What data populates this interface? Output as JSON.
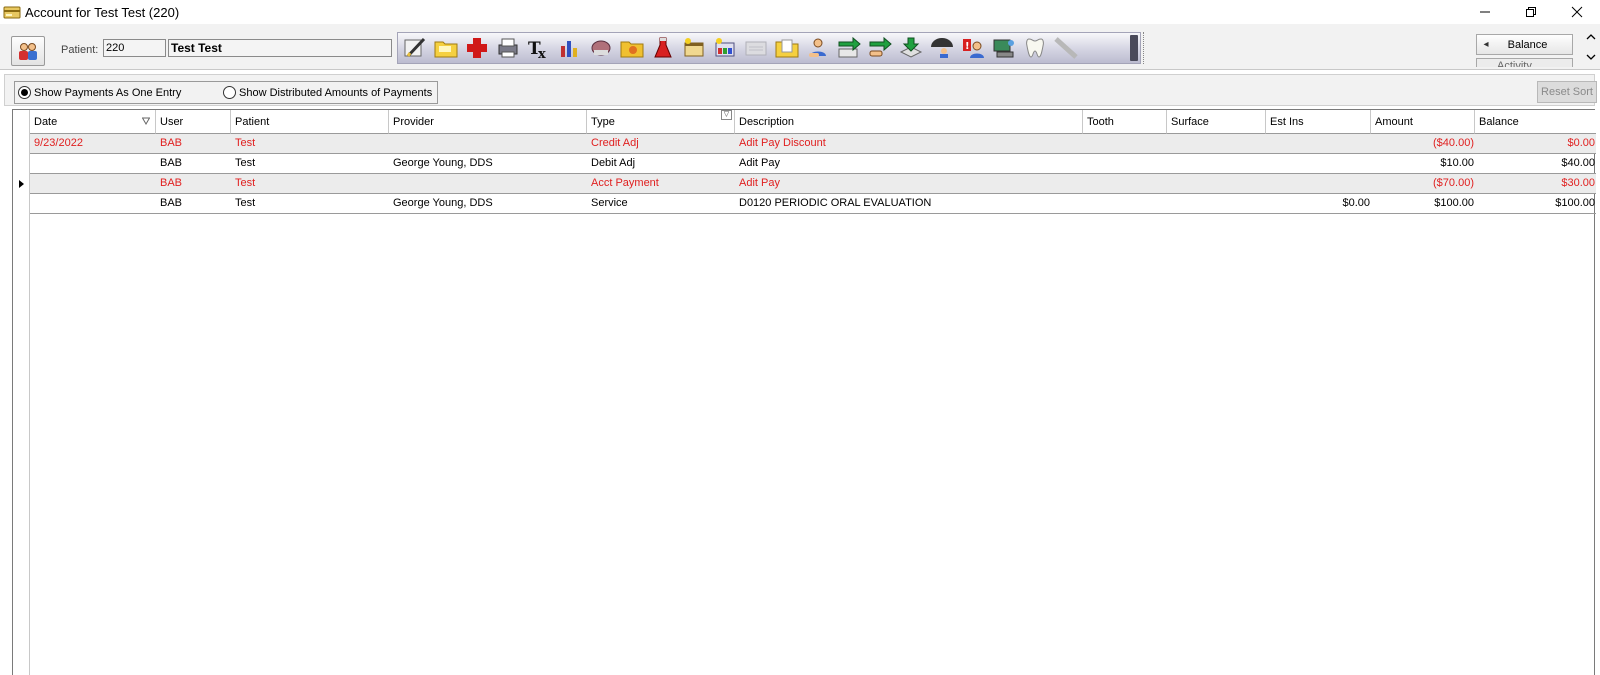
{
  "window": {
    "title": "Account for Test Test (220)"
  },
  "header": {
    "patient_label": "Patient:",
    "patient_num": "220",
    "patient_name": "Test Test",
    "toolbar_icons": [
      "edit-pen-icon",
      "folder-icon",
      "medical-cross-icon",
      "printer-icon",
      "tx-icon",
      "chart-bars-icon",
      "tooth-pink-icon",
      "folder-orange-icon",
      "flask-icon",
      "new-window-icon",
      "new-window-color-icon",
      "blank-card-icon",
      "folder-open-icon",
      "user-hand-icon",
      "arrow-right-green-icon",
      "arrow-right-hand-icon",
      "download-tray-icon",
      "umbrella-person-icon",
      "alert-person-icon",
      "computer-icon",
      "tooth-icon",
      "ruler-icon"
    ],
    "balance_label": "Balance",
    "activity_label": "Activity"
  },
  "options": {
    "radio_one_label": "Show Payments As One Entry",
    "radio_two_label": "Show Distributed Amounts of Payments",
    "reset_sort_label": "Reset Sort"
  },
  "grid": {
    "columns": [
      "Date",
      "User",
      "Patient",
      "Provider",
      "Type",
      "Description",
      "Tooth",
      "Surface",
      "Est Ins",
      "Amount",
      "Balance"
    ],
    "rows": [
      {
        "date": "9/23/2022",
        "user": "BAB",
        "patient": "Test",
        "provider": "",
        "type": "Credit Adj",
        "description": "Adit Pay Discount",
        "tooth": "",
        "surface": "",
        "est_ins": "",
        "amount": "($40.00)",
        "balance": "$0.00"
      },
      {
        "date": "",
        "user": "BAB",
        "patient": "Test",
        "provider": "George Young, DDS",
        "type": "Debit Adj",
        "description": "Adit Pay",
        "tooth": "",
        "surface": "",
        "est_ins": "",
        "amount": "$10.00",
        "balance": "$40.00"
      },
      {
        "date": "",
        "user": "BAB",
        "patient": "Test",
        "provider": "",
        "type": "Acct Payment",
        "description": "Adit Pay",
        "tooth": "",
        "surface": "",
        "est_ins": "",
        "amount": "($70.00)",
        "balance": "$30.00"
      },
      {
        "date": "",
        "user": "BAB",
        "patient": "Test",
        "provider": "George Young, DDS",
        "type": "Service",
        "description": "D0120 PERIODIC ORAL EVALUATION",
        "tooth": "",
        "surface": "",
        "est_ins": "$0.00",
        "amount": "$100.00",
        "balance": "$100.00"
      }
    ]
  },
  "colors": {
    "red_text": "#e02020",
    "row_shade": "#ececec"
  }
}
